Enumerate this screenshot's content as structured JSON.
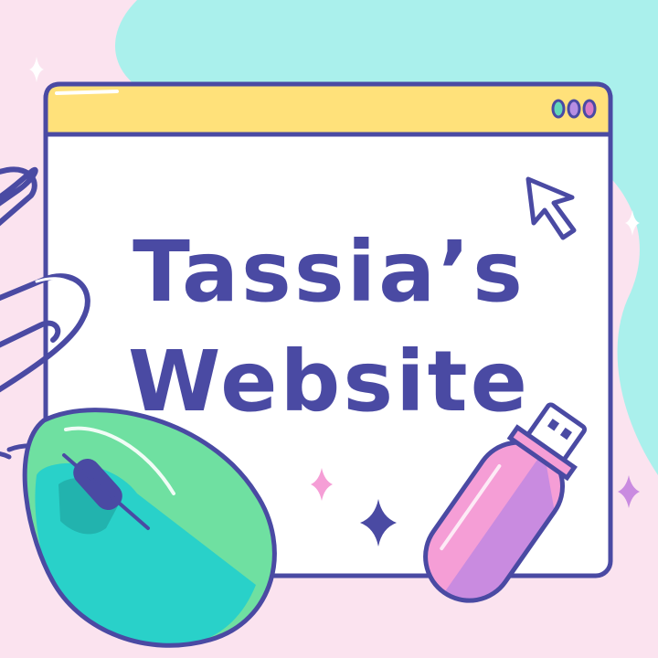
{
  "title": {
    "line1": "Tassia’s",
    "line2": "Website"
  },
  "window": {
    "controls": [
      {
        "icon": "dot",
        "color": "#63d7b8"
      },
      {
        "icon": "dot",
        "color": "#b68ee3"
      },
      {
        "icon": "dot",
        "color": "#d77ac6"
      }
    ]
  },
  "colors": {
    "background_pink": "#fbe3ef",
    "background_teal": "#aaf0ec",
    "title_bar": "#ffe17a",
    "outline": "#4a4aa3",
    "mouse_green": "#6fe0a1",
    "mouse_teal": "#29d1c9",
    "usb_pink": "#f59ed6",
    "usb_purple": "#c98be0"
  },
  "icons": [
    "paperclip-icon",
    "cursor-arrow-icon",
    "computer-mouse-icon",
    "usb-drive-icon",
    "sparkle-icon"
  ]
}
